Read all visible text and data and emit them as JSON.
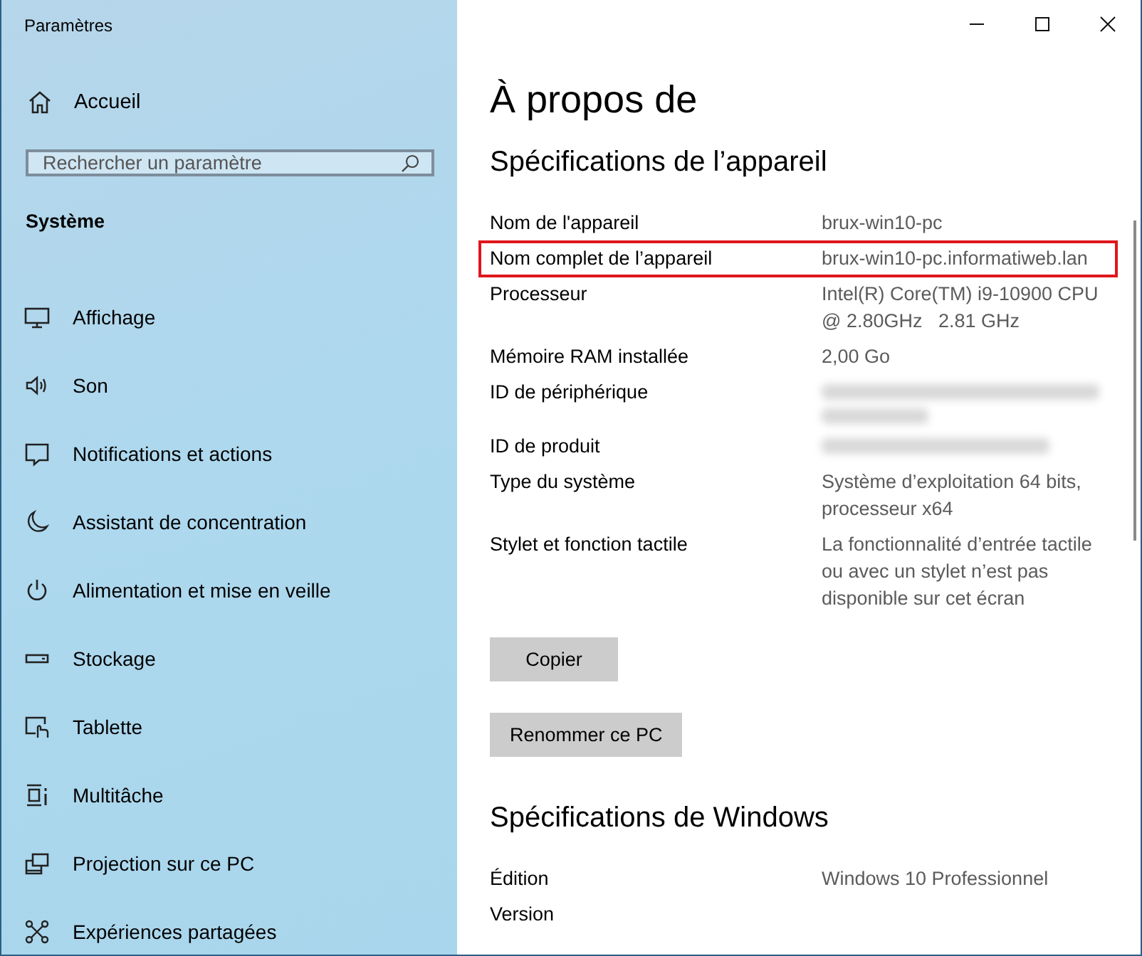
{
  "window": {
    "title": "Paramètres",
    "controls": [
      {
        "kind": "minimize"
      },
      {
        "kind": "maximize"
      },
      {
        "kind": "close"
      }
    ]
  },
  "sidebar": {
    "home": {
      "label": "Accueil"
    },
    "search": {
      "placeholder": "Rechercher un paramètre"
    },
    "section": "Système",
    "items": [
      {
        "label": "Affichage"
      },
      {
        "label": "Son"
      },
      {
        "label": "Notifications et actions"
      },
      {
        "label": "Assistant de concentration"
      },
      {
        "label": "Alimentation et mise en veille"
      },
      {
        "label": "Stockage"
      },
      {
        "label": "Tablette"
      },
      {
        "label": "Multitâche"
      },
      {
        "label": "Projection sur ce PC"
      },
      {
        "label": "Expériences partagées"
      }
    ]
  },
  "content": {
    "title": "À propos de",
    "device_specs": {
      "heading": "Spécifications de l’appareil",
      "rows": [
        {
          "label": "Nom de l'appareil",
          "kind": "text",
          "value": [
            "brux-win10-pc"
          ],
          "highlighted": false
        },
        {
          "label": "Nom complet de l’appareil",
          "kind": "text",
          "value": [
            "brux-win10-pc.informatiweb.lan"
          ],
          "highlighted": true
        },
        {
          "label": "Processeur",
          "kind": "text",
          "value": [
            "Intel(R) Core(TM) i9-10900 CPU",
            "@ 2.80GHz   2.81 GHz"
          ],
          "highlighted": false
        },
        {
          "label": "Mémoire RAM installée",
          "kind": "text",
          "value": [
            "2,00 Go"
          ],
          "highlighted": false
        },
        {
          "label": "ID de périphérique",
          "kind": "blurred_block",
          "highlighted": false
        },
        {
          "label": "ID de produit",
          "kind": "blurred_line",
          "highlighted": false
        },
        {
          "label": "Type du système",
          "kind": "text",
          "value": [
            "Système d’exploitation 64 bits,",
            "processeur x64"
          ],
          "highlighted": false
        },
        {
          "label": "Stylet et fonction tactile",
          "kind": "text",
          "value": [
            "La fonctionnalité d’entrée tactile",
            "ou avec un stylet n’est pas",
            "disponible sur cet écran"
          ],
          "highlighted": false
        }
      ],
      "buttons": [
        "Copier",
        "Renommer ce PC"
      ]
    },
    "windows_specs": {
      "heading": "Spécifications de Windows",
      "rows": [
        {
          "label": "Édition",
          "kind": "text",
          "value": [
            "Windows 10 Professionnel"
          ],
          "highlighted": false
        },
        {
          "label": "Version",
          "kind": "text",
          "value": [],
          "highlighted": false
        }
      ]
    }
  }
}
